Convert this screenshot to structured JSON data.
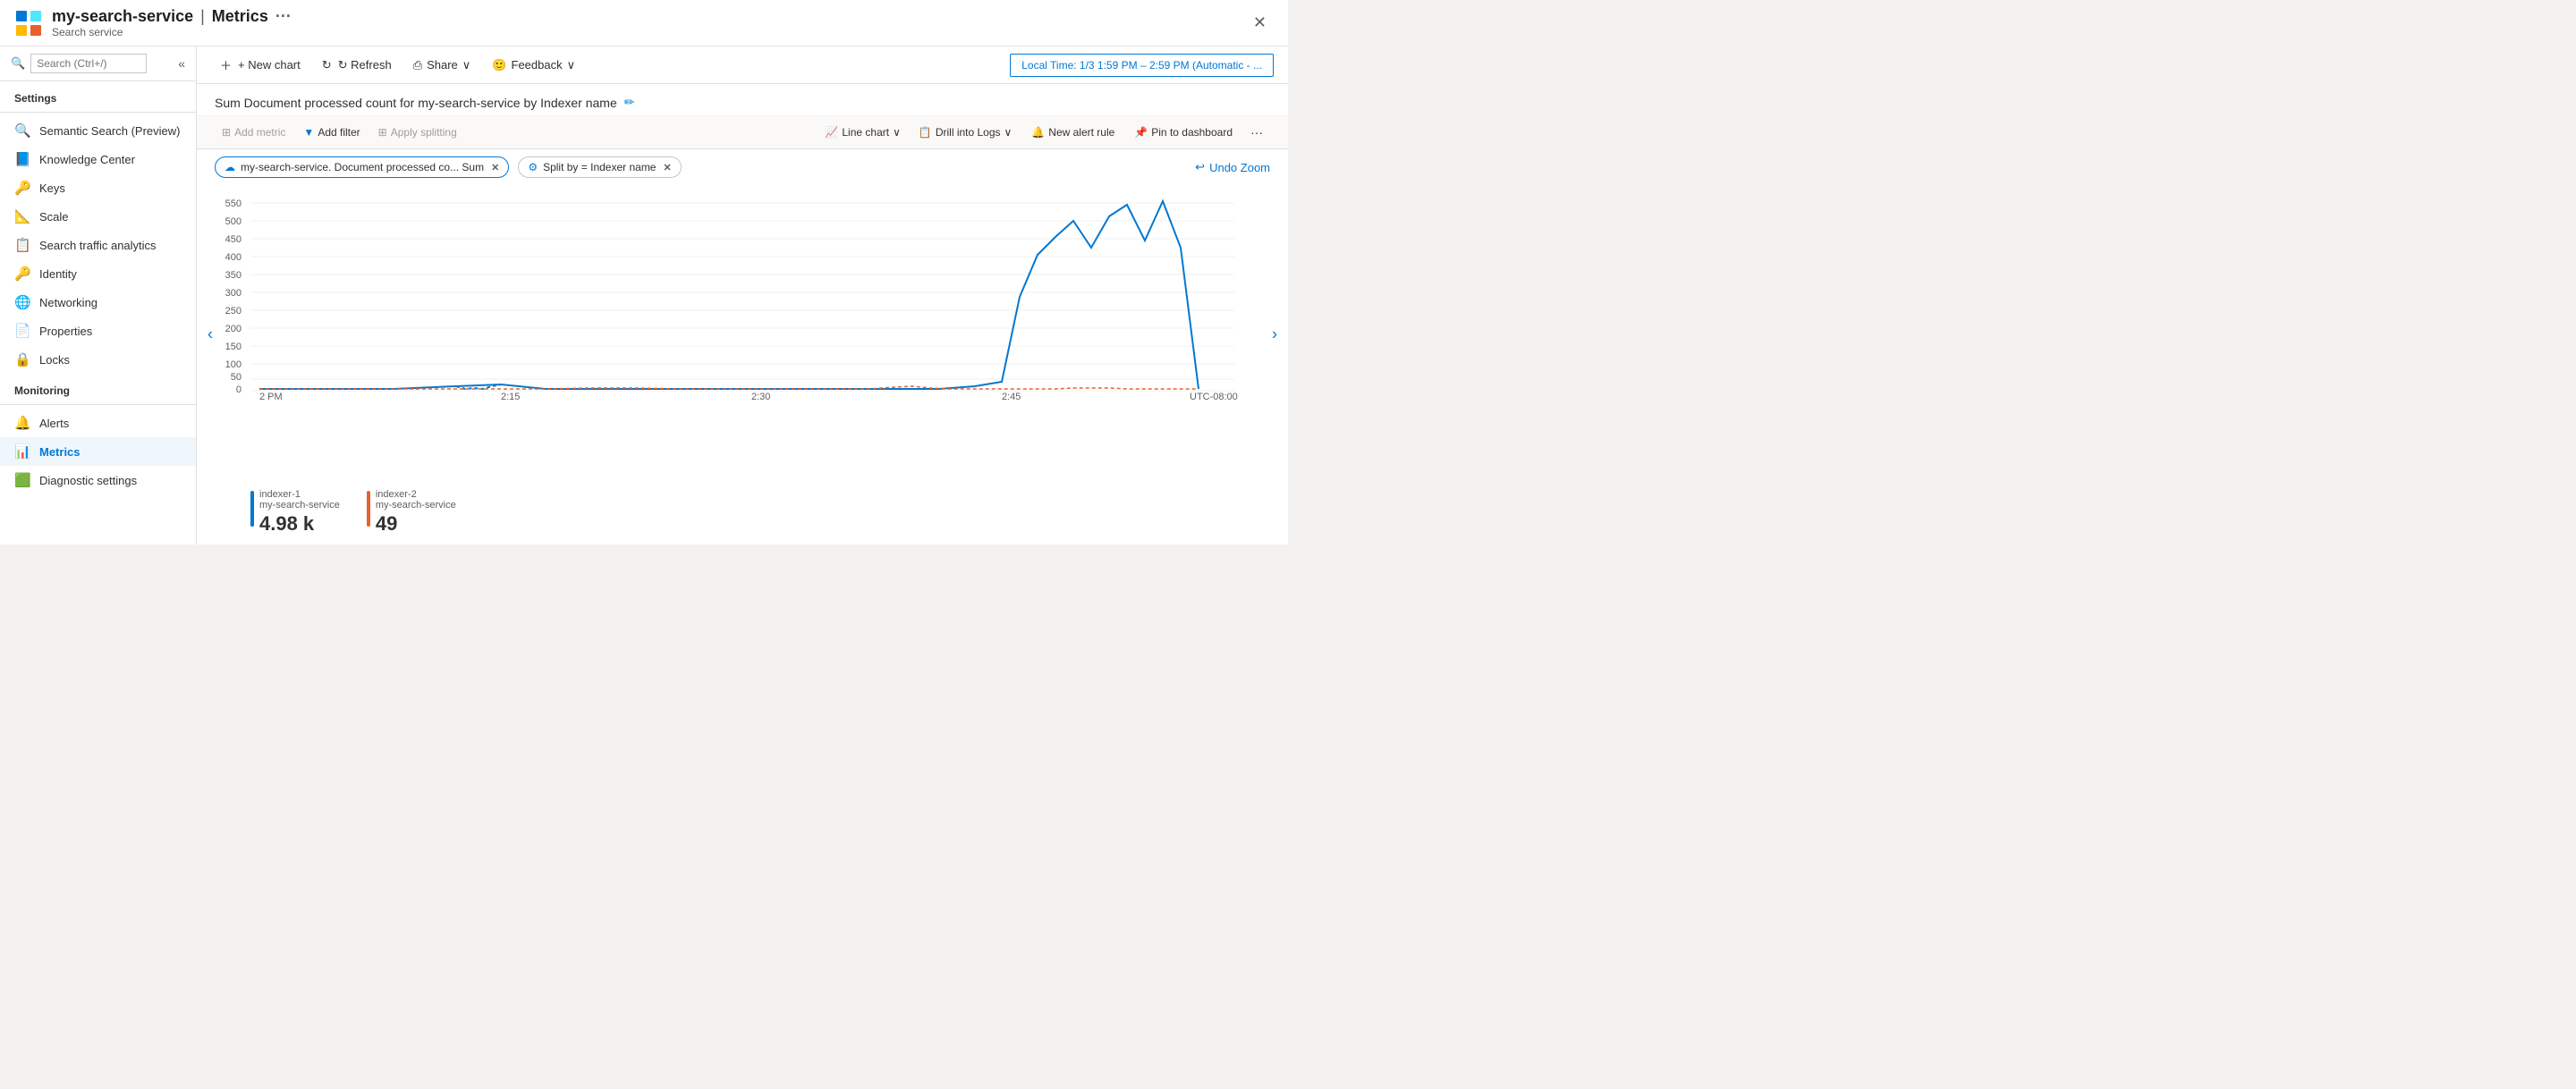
{
  "title_bar": {
    "service_name": "my-search-service",
    "divider": "|",
    "page_title": "Metrics",
    "more_icon": "···",
    "subtitle": "Search service",
    "close_icon": "✕"
  },
  "toolbar": {
    "new_chart_label": "+ New chart",
    "refresh_label": "↻ Refresh",
    "share_label": "⎙ Share",
    "share_chevron": "∨",
    "feedback_label": "🙂 Feedback",
    "feedback_chevron": "∨",
    "time_range": "Local Time: 1/3 1:59 PM – 2:59 PM (Automatic - ..."
  },
  "sidebar": {
    "search_placeholder": "Search (Ctrl+/)",
    "settings_label": "Settings",
    "monitoring_label": "Monitoring",
    "items": [
      {
        "id": "semantic-search",
        "label": "Semantic Search (Preview)",
        "icon": "🔍",
        "active": false
      },
      {
        "id": "knowledge-center",
        "label": "Knowledge Center",
        "icon": "📘",
        "active": false
      },
      {
        "id": "keys",
        "label": "Keys",
        "icon": "🔑",
        "active": false
      },
      {
        "id": "scale",
        "label": "Scale",
        "icon": "📐",
        "active": false
      },
      {
        "id": "search-traffic",
        "label": "Search traffic analytics",
        "icon": "📋",
        "active": false
      },
      {
        "id": "identity",
        "label": "Identity",
        "icon": "🔑",
        "active": false
      },
      {
        "id": "networking",
        "label": "Networking",
        "icon": "🌐",
        "active": false
      },
      {
        "id": "properties",
        "label": "Properties",
        "icon": "📄",
        "active": false
      },
      {
        "id": "locks",
        "label": "Locks",
        "icon": "🔒",
        "active": false
      },
      {
        "id": "alerts",
        "label": "Alerts",
        "icon": "🔔",
        "active": false
      },
      {
        "id": "metrics",
        "label": "Metrics",
        "icon": "📊",
        "active": true
      },
      {
        "id": "diagnostic",
        "label": "Diagnostic settings",
        "icon": "🟩",
        "active": false
      }
    ]
  },
  "chart": {
    "title": "Sum Document processed count for my-search-service by Indexer name",
    "edit_icon": "✏",
    "add_metric_label": "Add metric",
    "add_filter_label": "Add filter",
    "apply_splitting_label": "Apply splitting",
    "chart_type_label": "Line chart",
    "chart_type_chevron": "∨",
    "drill_logs_label": "Drill into Logs",
    "drill_chevron": "∨",
    "new_alert_label": "New alert rule",
    "pin_label": "Pin to dashboard",
    "more_icon": "···",
    "metric_chip": "my-search-service. Document processed co...  Sum",
    "split_chip": "Split by = Indexer name",
    "undo_zoom_label": "↩ Undo Zoom",
    "y_axis": [
      550,
      500,
      450,
      400,
      350,
      300,
      250,
      200,
      150,
      100,
      50,
      0
    ],
    "x_axis": [
      "2 PM",
      "2:15",
      "2:30",
      "2:45",
      "UTC-08:00"
    ],
    "legend": [
      {
        "id": "indexer-1",
        "title": "indexer-1",
        "subtitle": "my-search-service",
        "value": "4.98 k",
        "color": "#0078d4"
      },
      {
        "id": "indexer-2",
        "title": "indexer-2",
        "subtitle": "my-search-service",
        "value": "49",
        "color": "#e8612c"
      }
    ]
  }
}
